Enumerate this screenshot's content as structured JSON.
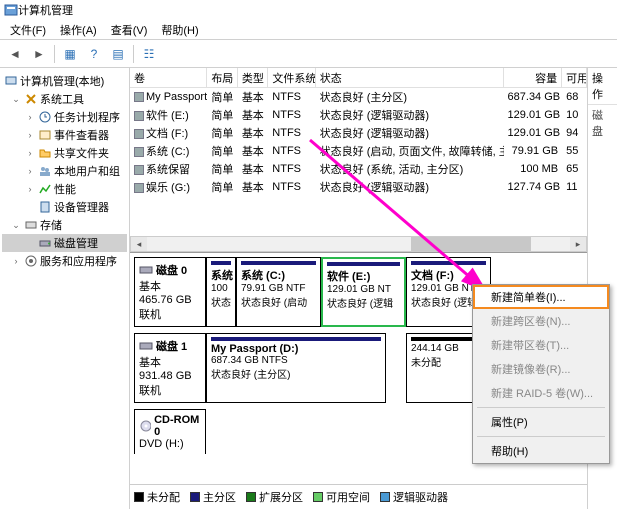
{
  "window": {
    "title": "计算机管理"
  },
  "menu": {
    "file": "文件(F)",
    "action": "操作(A)",
    "view": "查看(V)",
    "help": "帮助(H)"
  },
  "tree": {
    "root": "计算机管理(本地)",
    "systools": "系统工具",
    "task": "任务计划程序",
    "event": "事件查看器",
    "shared": "共享文件夹",
    "users": "本地用户和组",
    "perf": "性能",
    "devmgr": "设备管理器",
    "storage": "存储",
    "diskmgmt": "磁盘管理",
    "services": "服务和应用程序"
  },
  "ops": {
    "header": "操作",
    "item": "磁盘"
  },
  "cols": {
    "vol": "卷",
    "layout": "布局",
    "type": "类型",
    "fs": "文件系统",
    "status": "状态",
    "cap": "容量",
    "free": "可用"
  },
  "vols": [
    {
      "n": "My Passport (D:)",
      "l": "简单",
      "t": "基本",
      "fs": "NTFS",
      "st": "状态良好 (主分区)",
      "cap": "687.34 GB",
      "fr": "68"
    },
    {
      "n": "软件 (E:)",
      "l": "简单",
      "t": "基本",
      "fs": "NTFS",
      "st": "状态良好 (逻辑驱动器)",
      "cap": "129.01 GB",
      "fr": "10"
    },
    {
      "n": "文档 (F:)",
      "l": "简单",
      "t": "基本",
      "fs": "NTFS",
      "st": "状态良好 (逻辑驱动器)",
      "cap": "129.01 GB",
      "fr": "94"
    },
    {
      "n": "系统 (C:)",
      "l": "简单",
      "t": "基本",
      "fs": "NTFS",
      "st": "状态良好 (启动, 页面文件, 故障转储, 主分区)",
      "cap": "79.91 GB",
      "fr": "55"
    },
    {
      "n": "系统保留",
      "l": "简单",
      "t": "基本",
      "fs": "NTFS",
      "st": "状态良好 (系统, 活动, 主分区)",
      "cap": "100 MB",
      "fr": "65"
    },
    {
      "n": "娱乐 (G:)",
      "l": "简单",
      "t": "基本",
      "fs": "NTFS",
      "st": "状态良好 (逻辑驱动器)",
      "cap": "127.74 GB",
      "fr": "11"
    }
  ],
  "disk0": {
    "label": "磁盘 0",
    "type": "基本",
    "size": "465.76 GB",
    "state": "联机",
    "parts": [
      {
        "n": "系统",
        "sz": "100",
        "st": "状态"
      },
      {
        "n": "系统  (C:)",
        "sz": "79.91 GB NTF",
        "st": "状态良好 (启动"
      },
      {
        "n": "软件  (E:)",
        "sz": "129.01 GB NT",
        "st": "状态良好 (逻辑"
      },
      {
        "n": "文档  (F:)",
        "sz": "129.01 GB NT",
        "st": "状态良好 (逻辑"
      }
    ]
  },
  "disk1": {
    "label": "磁盘 1",
    "type": "基本",
    "size": "931.48 GB",
    "state": "联机",
    "parts": [
      {
        "n": "My Passport  (D:)",
        "sz": "687.34 GB NTFS",
        "st": "状态良好 (主分区)"
      },
      {
        "n": "",
        "sz": "244.14 GB",
        "st": "未分配"
      }
    ]
  },
  "cdrom": {
    "label": "CD-ROM 0",
    "dev": "DVD (H:)"
  },
  "legend": {
    "unalloc": "未分配",
    "primary": "主分区",
    "ext": "扩展分区",
    "free": "可用空间",
    "logical": "逻辑驱动器"
  },
  "ctx": {
    "simple": "新建简单卷(I)...",
    "span": "新建跨区卷(N)...",
    "stripe": "新建带区卷(T)...",
    "mirror": "新建镜像卷(R)...",
    "raid5": "新建 RAID-5 卷(W)...",
    "prop": "属性(P)",
    "help": "帮助(H)"
  }
}
